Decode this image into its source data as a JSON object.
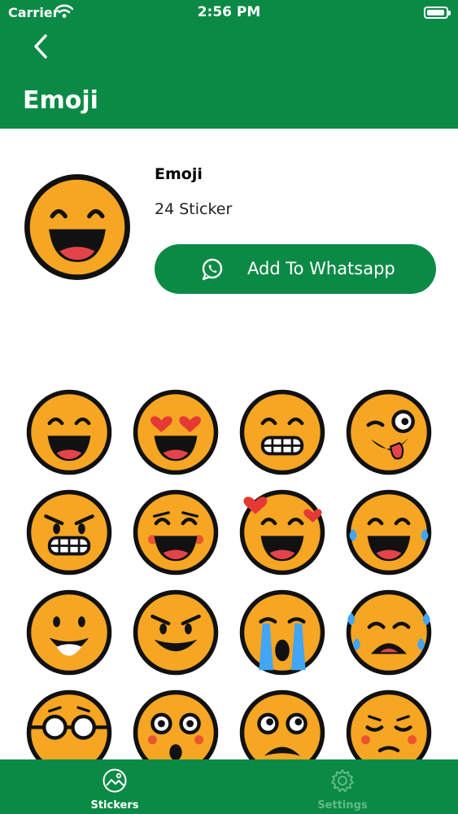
{
  "status_bar": {
    "carrier": "Carrier",
    "time": "2:56 PM"
  },
  "nav": {
    "title": "Emoji"
  },
  "pack": {
    "name": "Emoji",
    "count": "24 Sticker",
    "add_button_label": "Add To Whatsapp"
  },
  "colors": {
    "brand": "#0b8a45",
    "emoji_fill": "#f6a623",
    "tab_inactive": "#5fbb86"
  },
  "stickers": [
    "grinning-face",
    "heart-eyes-face",
    "grimacing-face",
    "winking-tongue-face",
    "angry-grimace-face",
    "blushing-laughing-face",
    "smiling-face-with-hearts",
    "tears-of-joy-face",
    "smiling-face",
    "devilish-grin-face",
    "loudly-crying-face",
    "sobbing-face",
    "nerd-glasses-face",
    "astonished-face",
    "frowning-face",
    "relieved-face"
  ],
  "tabbar": {
    "items": [
      {
        "label": "Stickers",
        "icon": "sticker-icon",
        "active": true
      },
      {
        "label": "Settings",
        "icon": "gear-icon",
        "active": false
      }
    ]
  }
}
